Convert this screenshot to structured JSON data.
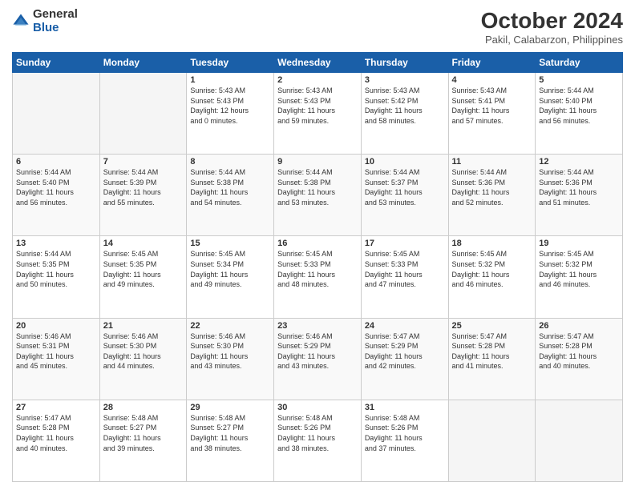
{
  "header": {
    "logo_general": "General",
    "logo_blue": "Blue",
    "title": "October 2024",
    "subtitle": "Pakil, Calabarzon, Philippines"
  },
  "days_of_week": [
    "Sunday",
    "Monday",
    "Tuesday",
    "Wednesday",
    "Thursday",
    "Friday",
    "Saturday"
  ],
  "weeks": [
    [
      {
        "day": "",
        "info": ""
      },
      {
        "day": "",
        "info": ""
      },
      {
        "day": "1",
        "info": "Sunrise: 5:43 AM\nSunset: 5:43 PM\nDaylight: 12 hours\nand 0 minutes."
      },
      {
        "day": "2",
        "info": "Sunrise: 5:43 AM\nSunset: 5:43 PM\nDaylight: 11 hours\nand 59 minutes."
      },
      {
        "day": "3",
        "info": "Sunrise: 5:43 AM\nSunset: 5:42 PM\nDaylight: 11 hours\nand 58 minutes."
      },
      {
        "day": "4",
        "info": "Sunrise: 5:43 AM\nSunset: 5:41 PM\nDaylight: 11 hours\nand 57 minutes."
      },
      {
        "day": "5",
        "info": "Sunrise: 5:44 AM\nSunset: 5:40 PM\nDaylight: 11 hours\nand 56 minutes."
      }
    ],
    [
      {
        "day": "6",
        "info": "Sunrise: 5:44 AM\nSunset: 5:40 PM\nDaylight: 11 hours\nand 56 minutes."
      },
      {
        "day": "7",
        "info": "Sunrise: 5:44 AM\nSunset: 5:39 PM\nDaylight: 11 hours\nand 55 minutes."
      },
      {
        "day": "8",
        "info": "Sunrise: 5:44 AM\nSunset: 5:38 PM\nDaylight: 11 hours\nand 54 minutes."
      },
      {
        "day": "9",
        "info": "Sunrise: 5:44 AM\nSunset: 5:38 PM\nDaylight: 11 hours\nand 53 minutes."
      },
      {
        "day": "10",
        "info": "Sunrise: 5:44 AM\nSunset: 5:37 PM\nDaylight: 11 hours\nand 53 minutes."
      },
      {
        "day": "11",
        "info": "Sunrise: 5:44 AM\nSunset: 5:36 PM\nDaylight: 11 hours\nand 52 minutes."
      },
      {
        "day": "12",
        "info": "Sunrise: 5:44 AM\nSunset: 5:36 PM\nDaylight: 11 hours\nand 51 minutes."
      }
    ],
    [
      {
        "day": "13",
        "info": "Sunrise: 5:44 AM\nSunset: 5:35 PM\nDaylight: 11 hours\nand 50 minutes."
      },
      {
        "day": "14",
        "info": "Sunrise: 5:45 AM\nSunset: 5:35 PM\nDaylight: 11 hours\nand 49 minutes."
      },
      {
        "day": "15",
        "info": "Sunrise: 5:45 AM\nSunset: 5:34 PM\nDaylight: 11 hours\nand 49 minutes."
      },
      {
        "day": "16",
        "info": "Sunrise: 5:45 AM\nSunset: 5:33 PM\nDaylight: 11 hours\nand 48 minutes."
      },
      {
        "day": "17",
        "info": "Sunrise: 5:45 AM\nSunset: 5:33 PM\nDaylight: 11 hours\nand 47 minutes."
      },
      {
        "day": "18",
        "info": "Sunrise: 5:45 AM\nSunset: 5:32 PM\nDaylight: 11 hours\nand 46 minutes."
      },
      {
        "day": "19",
        "info": "Sunrise: 5:45 AM\nSunset: 5:32 PM\nDaylight: 11 hours\nand 46 minutes."
      }
    ],
    [
      {
        "day": "20",
        "info": "Sunrise: 5:46 AM\nSunset: 5:31 PM\nDaylight: 11 hours\nand 45 minutes."
      },
      {
        "day": "21",
        "info": "Sunrise: 5:46 AM\nSunset: 5:30 PM\nDaylight: 11 hours\nand 44 minutes."
      },
      {
        "day": "22",
        "info": "Sunrise: 5:46 AM\nSunset: 5:30 PM\nDaylight: 11 hours\nand 43 minutes."
      },
      {
        "day": "23",
        "info": "Sunrise: 5:46 AM\nSunset: 5:29 PM\nDaylight: 11 hours\nand 43 minutes."
      },
      {
        "day": "24",
        "info": "Sunrise: 5:47 AM\nSunset: 5:29 PM\nDaylight: 11 hours\nand 42 minutes."
      },
      {
        "day": "25",
        "info": "Sunrise: 5:47 AM\nSunset: 5:28 PM\nDaylight: 11 hours\nand 41 minutes."
      },
      {
        "day": "26",
        "info": "Sunrise: 5:47 AM\nSunset: 5:28 PM\nDaylight: 11 hours\nand 40 minutes."
      }
    ],
    [
      {
        "day": "27",
        "info": "Sunrise: 5:47 AM\nSunset: 5:28 PM\nDaylight: 11 hours\nand 40 minutes."
      },
      {
        "day": "28",
        "info": "Sunrise: 5:48 AM\nSunset: 5:27 PM\nDaylight: 11 hours\nand 39 minutes."
      },
      {
        "day": "29",
        "info": "Sunrise: 5:48 AM\nSunset: 5:27 PM\nDaylight: 11 hours\nand 38 minutes."
      },
      {
        "day": "30",
        "info": "Sunrise: 5:48 AM\nSunset: 5:26 PM\nDaylight: 11 hours\nand 38 minutes."
      },
      {
        "day": "31",
        "info": "Sunrise: 5:48 AM\nSunset: 5:26 PM\nDaylight: 11 hours\nand 37 minutes."
      },
      {
        "day": "",
        "info": ""
      },
      {
        "day": "",
        "info": ""
      }
    ]
  ]
}
